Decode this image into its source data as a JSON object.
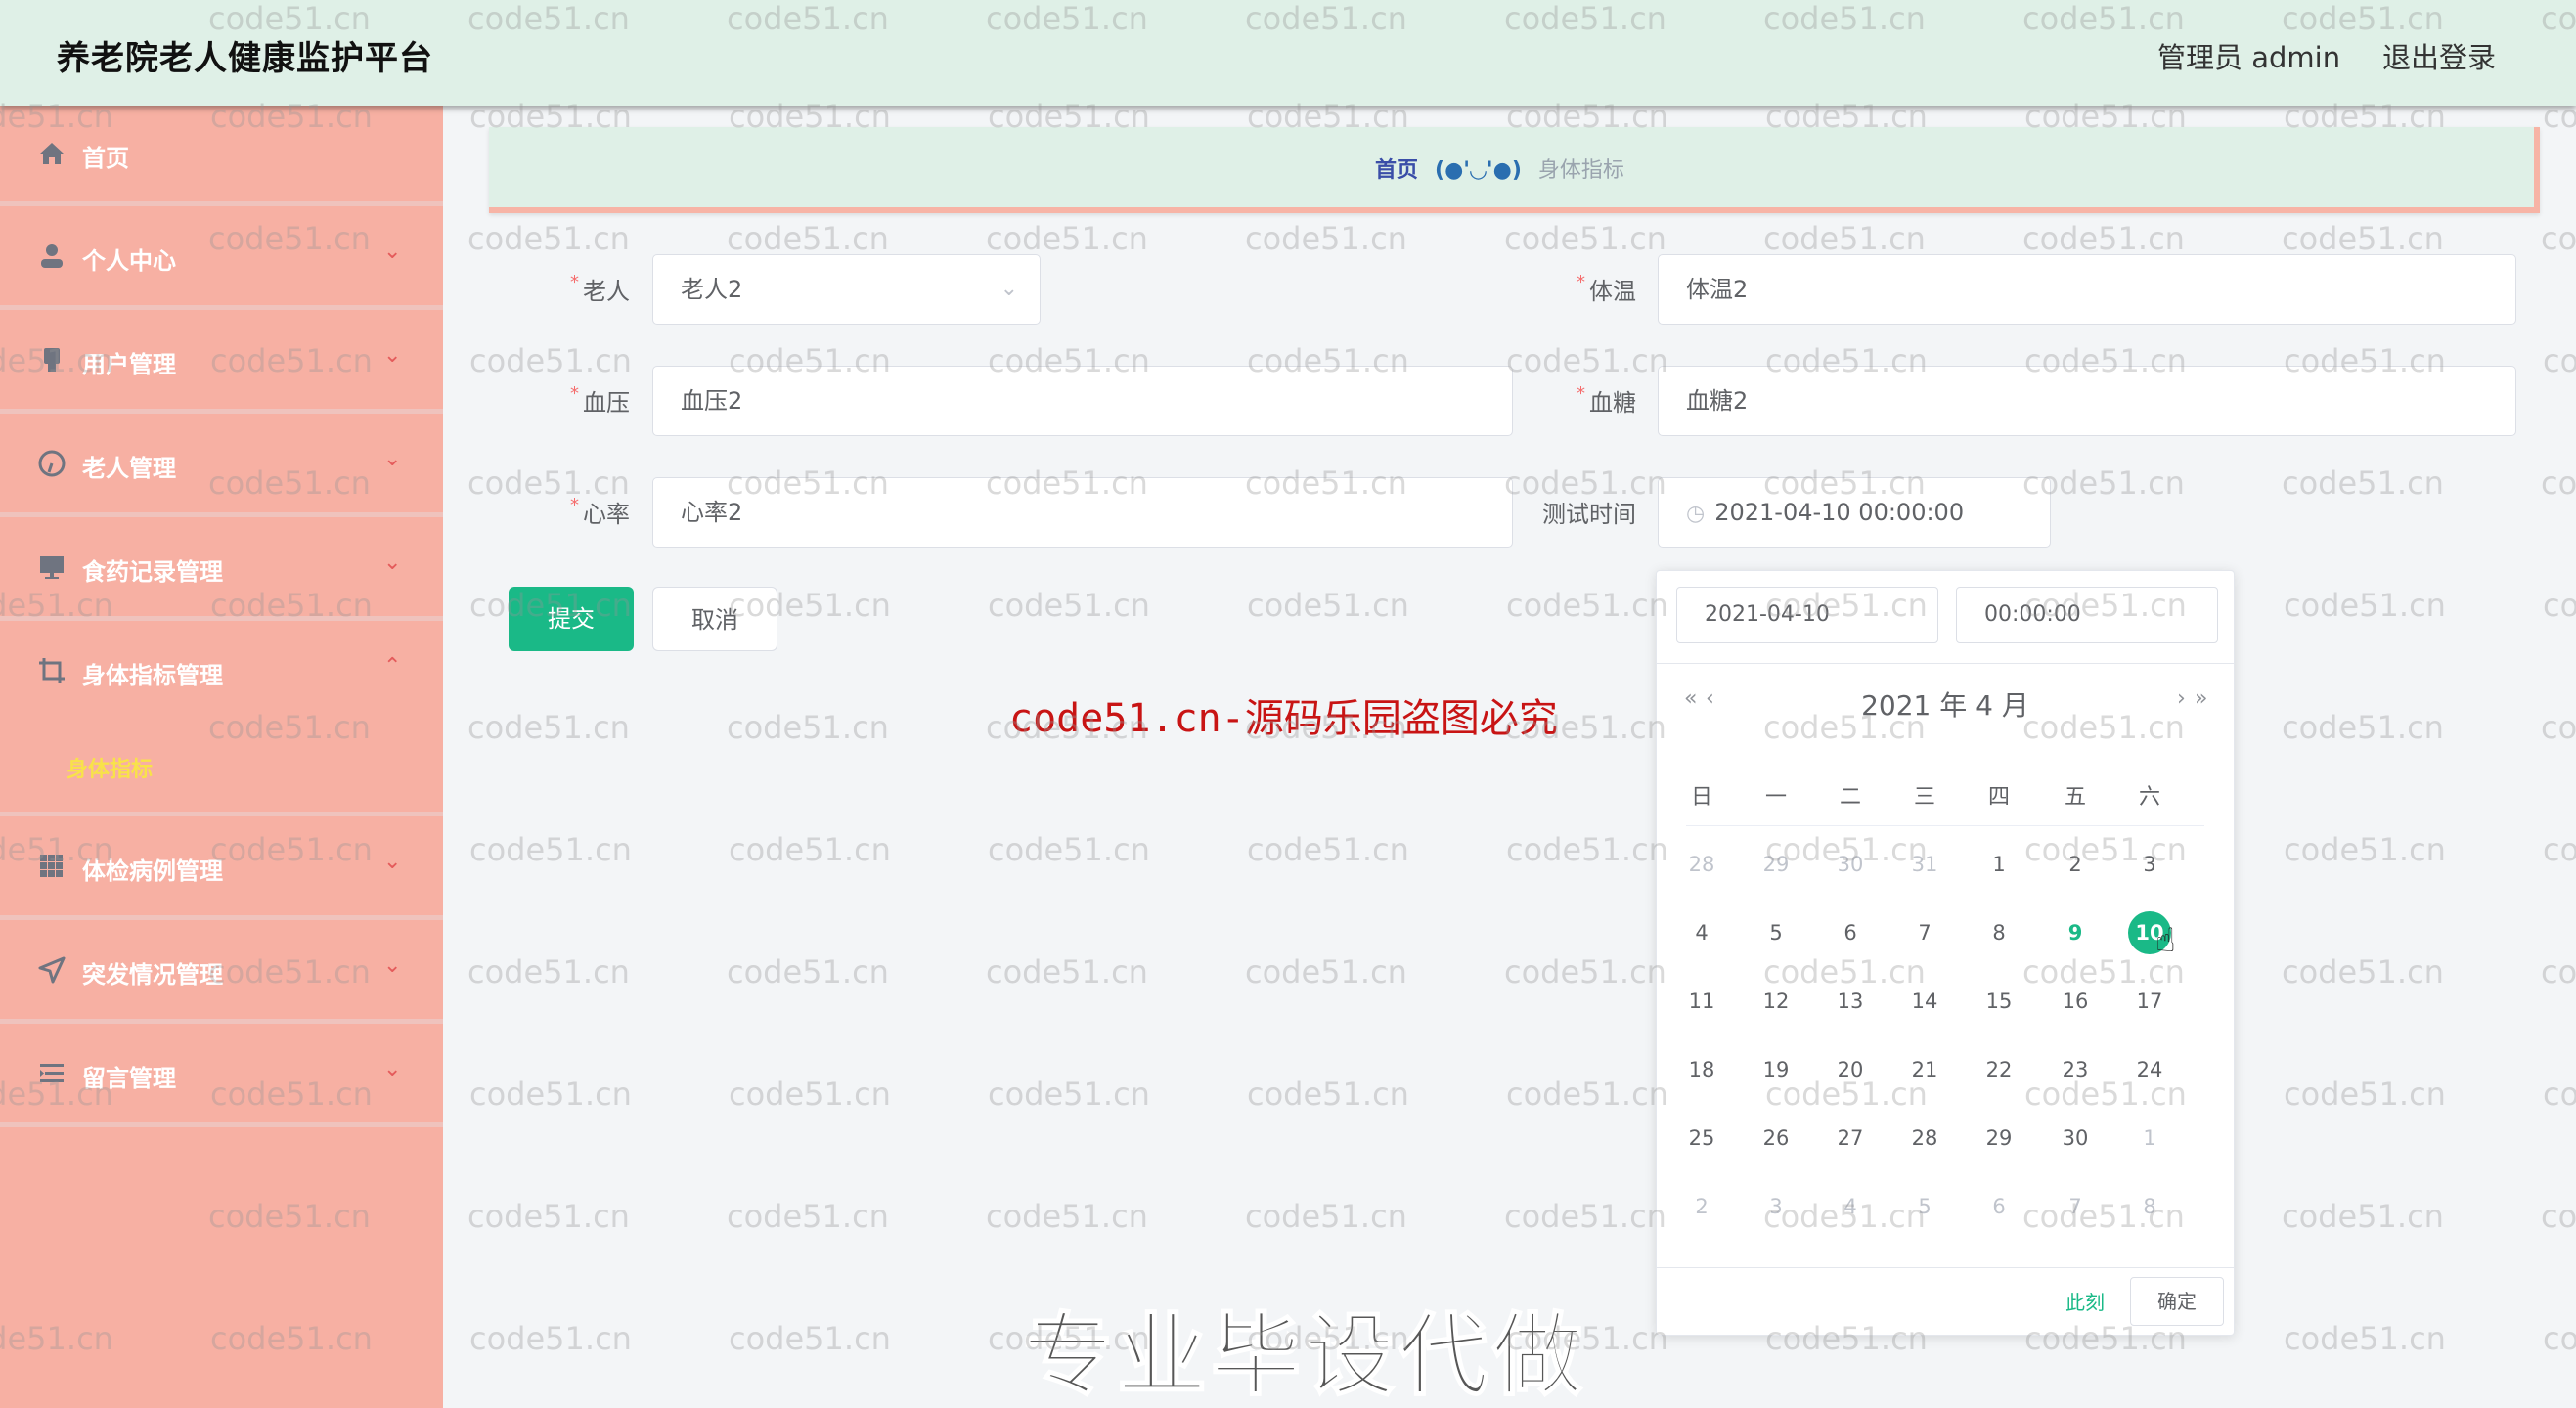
{
  "header": {
    "title": "养老院老人健康监护平台",
    "user_label": "管理员 admin",
    "logout_label": "退出登录"
  },
  "sidebar": {
    "items": [
      {
        "label": "首页",
        "icon": "home-icon",
        "has_arrow": false
      },
      {
        "label": "个人中心",
        "icon": "user-icon",
        "has_arrow": true
      },
      {
        "label": "用户管理",
        "icon": "users-icon",
        "has_arrow": true
      },
      {
        "label": "老人管理",
        "icon": "dashboard-icon",
        "has_arrow": true
      },
      {
        "label": "食药记录管理",
        "icon": "monitor-icon",
        "has_arrow": true
      },
      {
        "label": "身体指标管理",
        "icon": "crop-icon",
        "has_arrow": true,
        "expanded": true,
        "sub_items": [
          {
            "label": "身体指标",
            "active": true
          }
        ]
      },
      {
        "label": "体检病例管理",
        "icon": "grid-icon",
        "has_arrow": true
      },
      {
        "label": "突发情况管理",
        "icon": "send-icon",
        "has_arrow": true
      },
      {
        "label": "留言管理",
        "icon": "list-icon",
        "has_arrow": true
      }
    ],
    "arrow_down": "⌄",
    "arrow_up": "⌃"
  },
  "breadcrumb": {
    "home": "首页",
    "separator": "(●'◡'●)",
    "current": "身体指标"
  },
  "form": {
    "elder": {
      "label": "老人",
      "required": true,
      "value": "老人2"
    },
    "temperature": {
      "label": "体温",
      "required": true,
      "value": "体温2"
    },
    "blood_pressure": {
      "label": "血压",
      "required": true,
      "value": "血压2"
    },
    "blood_sugar": {
      "label": "血糖",
      "required": true,
      "value": "血糖2"
    },
    "heart_rate": {
      "label": "心率",
      "required": true,
      "value": "心率2"
    },
    "test_time": {
      "label": "测试时间",
      "required": false,
      "value": "2021-04-10 00:00:00"
    },
    "submit_label": "提交",
    "cancel_label": "取消"
  },
  "date_picker": {
    "date_input": "2021-04-10",
    "time_input": "00:00:00",
    "title": "2021 年  4 月",
    "prev_year": "«",
    "prev_month": "‹",
    "next_month": "›",
    "next_year": "»",
    "weekdays": [
      "日",
      "一",
      "二",
      "三",
      "四",
      "五",
      "六"
    ],
    "weeks": [
      [
        {
          "d": "28",
          "o": true
        },
        {
          "d": "29",
          "o": true
        },
        {
          "d": "30",
          "o": true
        },
        {
          "d": "31",
          "o": true
        },
        {
          "d": "1"
        },
        {
          "d": "2"
        },
        {
          "d": "3"
        }
      ],
      [
        {
          "d": "4"
        },
        {
          "d": "5"
        },
        {
          "d": "6"
        },
        {
          "d": "7"
        },
        {
          "d": "8"
        },
        {
          "d": "9",
          "today": true
        },
        {
          "d": "10",
          "selected": true
        }
      ],
      [
        {
          "d": "11"
        },
        {
          "d": "12"
        },
        {
          "d": "13"
        },
        {
          "d": "14"
        },
        {
          "d": "15"
        },
        {
          "d": "16"
        },
        {
          "d": "17"
        }
      ],
      [
        {
          "d": "18"
        },
        {
          "d": "19"
        },
        {
          "d": "20"
        },
        {
          "d": "21"
        },
        {
          "d": "22"
        },
        {
          "d": "23"
        },
        {
          "d": "24"
        }
      ],
      [
        {
          "d": "25"
        },
        {
          "d": "26"
        },
        {
          "d": "27"
        },
        {
          "d": "28"
        },
        {
          "d": "29"
        },
        {
          "d": "30"
        },
        {
          "d": "1",
          "o": true
        }
      ],
      [
        {
          "d": "2",
          "o": true
        },
        {
          "d": "3",
          "o": true
        },
        {
          "d": "4",
          "o": true
        },
        {
          "d": "5",
          "o": true
        },
        {
          "d": "6",
          "o": true
        },
        {
          "d": "7",
          "o": true
        },
        {
          "d": "8",
          "o": true
        }
      ]
    ],
    "now_label": "此刻",
    "confirm_label": "确定"
  },
  "overlays": {
    "watermark_text": "code51.cn",
    "red_notice": "code51.cn-源码乐园盗图必究",
    "banner": "专业毕设代做"
  },
  "colors": {
    "header_bg": "#dff0e7",
    "sidebar_bg": "#f7b0a3",
    "primary": "#1ab987",
    "submenu_active": "#f8e24a"
  }
}
